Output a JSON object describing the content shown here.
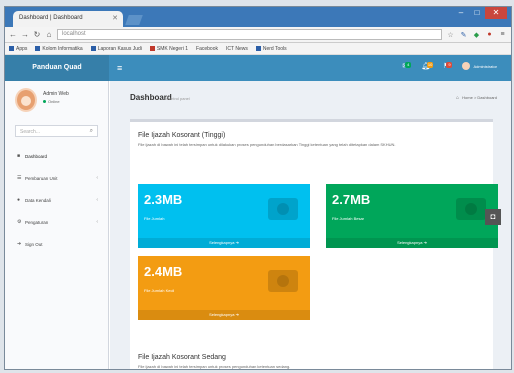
{
  "browser": {
    "tab_title": "Dashboard | Dashboard",
    "url": "localhost",
    "bookmarks": [
      "Apps",
      "Kolom Informatika",
      "Laporan Kasus Judi",
      "SMK Negeri 1",
      "Facebook",
      "ICT News",
      "Nerd Tools"
    ]
  },
  "header": {
    "brand": "Panduan Quad",
    "user_label": "Administrator",
    "badges": {
      "mail": "4",
      "notif": "10",
      "tasks": "9"
    },
    "colors": {
      "mail": "#00a65a",
      "notif": "#f39c12",
      "tasks": "#dd4b39"
    }
  },
  "sidebar": {
    "user_name": "Admin Web",
    "user_status": "Online",
    "search_placeholder": "Search...",
    "items": [
      {
        "label": "Dashboard",
        "icon": "dashboard-icon"
      },
      {
        "label": "Pembaruan Unit",
        "icon": "list-icon"
      },
      {
        "label": "Data Kendali",
        "icon": "data-icon"
      },
      {
        "label": "Pengaturan",
        "icon": "gear-icon"
      },
      {
        "label": "Sign Out",
        "icon": "sign-out-icon"
      }
    ]
  },
  "content": {
    "title": "Dashboard",
    "subtitle": "Control panel",
    "breadcrumb": [
      "Home",
      "Dashboard"
    ],
    "section1": {
      "title": "File Ijazah Kosorant (Tinggi)",
      "desc": "File ijazah di bawah ini telah tersimpan untuk dilakukan proses pengunduhan berdasarkan Tinggi ketentuan yang telah ditetapkan dalam SKHUN."
    },
    "section2": {
      "title": "File Ijazah Kosorant Sedang",
      "desc": "File ijazah di bawah ini telah tersimpan untuk proses pengunduhan ketentuan sedang."
    },
    "stats": [
      {
        "value": "2.3MB",
        "label": "File Jumlah",
        "footer": "Selengkapnya",
        "color": "#00c0ef"
      },
      {
        "value": "2.7MB",
        "label": "File Jumlah Besar",
        "footer": "Selengkapnya",
        "color": "#00a65a"
      },
      {
        "value": "2.4MB",
        "label": "File Jumlah Kecil",
        "footer": "Selengkapnya",
        "color": "#f39c12"
      }
    ]
  }
}
